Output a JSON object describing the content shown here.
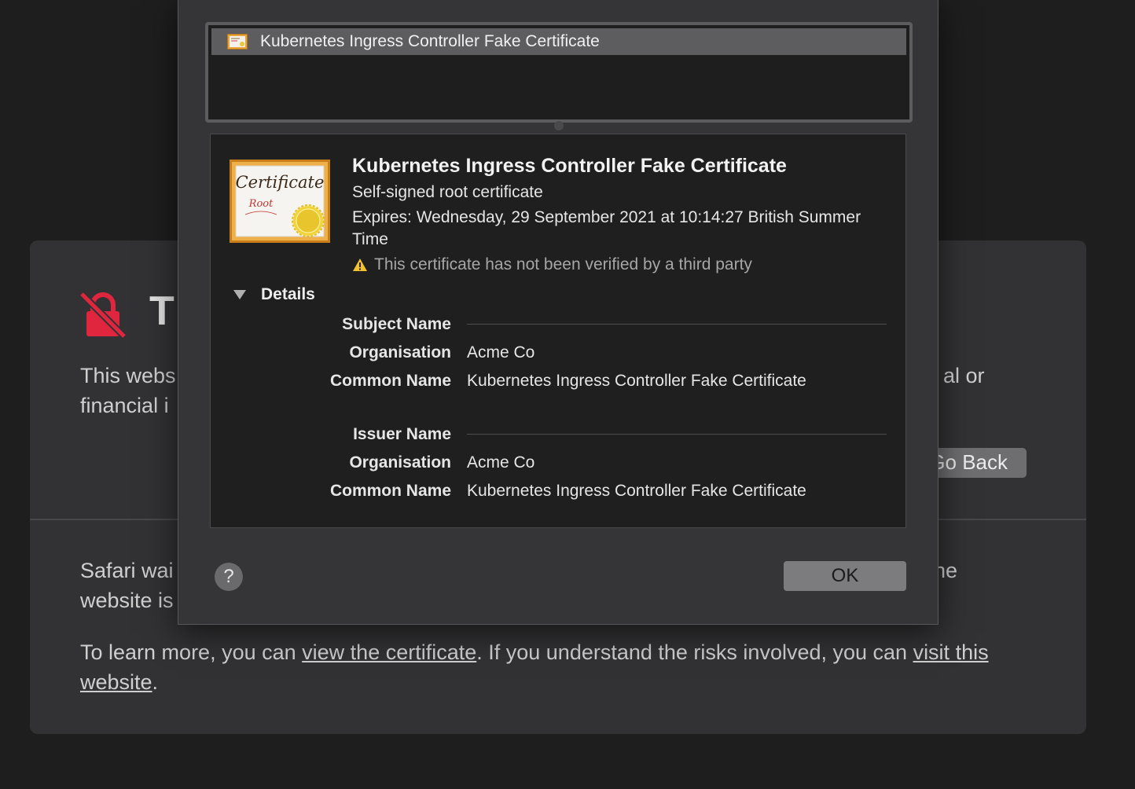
{
  "warning_page": {
    "title": "T",
    "description_left_line1": "This webs",
    "description_left_line2": "financial i",
    "description_right_line1": "al or",
    "go_back_label": "Go Back",
    "safari_warn_left_line1": "Safari wai",
    "safari_warn_left_line2": "website is",
    "safari_warn_right_line1": "he",
    "learn_more_prefix": "To learn more, you can ",
    "view_certificate_link": "view the certificate",
    "learn_more_middle": ". If you understand the risks involved, you can ",
    "visit_website_link": "visit this website",
    "learn_more_suffix": "."
  },
  "cert_list": {
    "selected_item": "Kubernetes Ingress Controller Fake Certificate"
  },
  "cert_details": {
    "title": "Kubernetes Ingress Controller Fake Certificate",
    "type": "Self-signed root certificate",
    "expires": "Expires: Wednesday, 29 September 2021 at 10:14:27 British Summer Time",
    "warning": "This certificate has not been verified by a third party",
    "details_label": "Details",
    "subject_name_label": "Subject Name",
    "subject_org_label": "Organisation",
    "subject_org_value": "Acme Co",
    "subject_cn_label": "Common Name",
    "subject_cn_value": "Kubernetes Ingress Controller Fake Certificate",
    "issuer_name_label": "Issuer Name",
    "issuer_org_label": "Organisation",
    "issuer_org_value": "Acme Co",
    "issuer_cn_label": "Common Name",
    "issuer_cn_value": "Kubernetes Ingress Controller Fake Certificate"
  },
  "big_cert_icon": {
    "word": "Certificate",
    "subword": "Root"
  },
  "buttons": {
    "help_label": "?",
    "ok_label": "OK"
  },
  "icons": {
    "warning_page_icon": "broken-lock-icon",
    "list_icon": "certificate-icon",
    "details_icon": "certificate-root-icon",
    "warning_icon": "warning-triangle-icon",
    "toggle_icon": "disclosure-triangle-down-icon"
  },
  "colors": {
    "lock_red": "#e0263f",
    "warning_yellow": "#f2c12e"
  }
}
